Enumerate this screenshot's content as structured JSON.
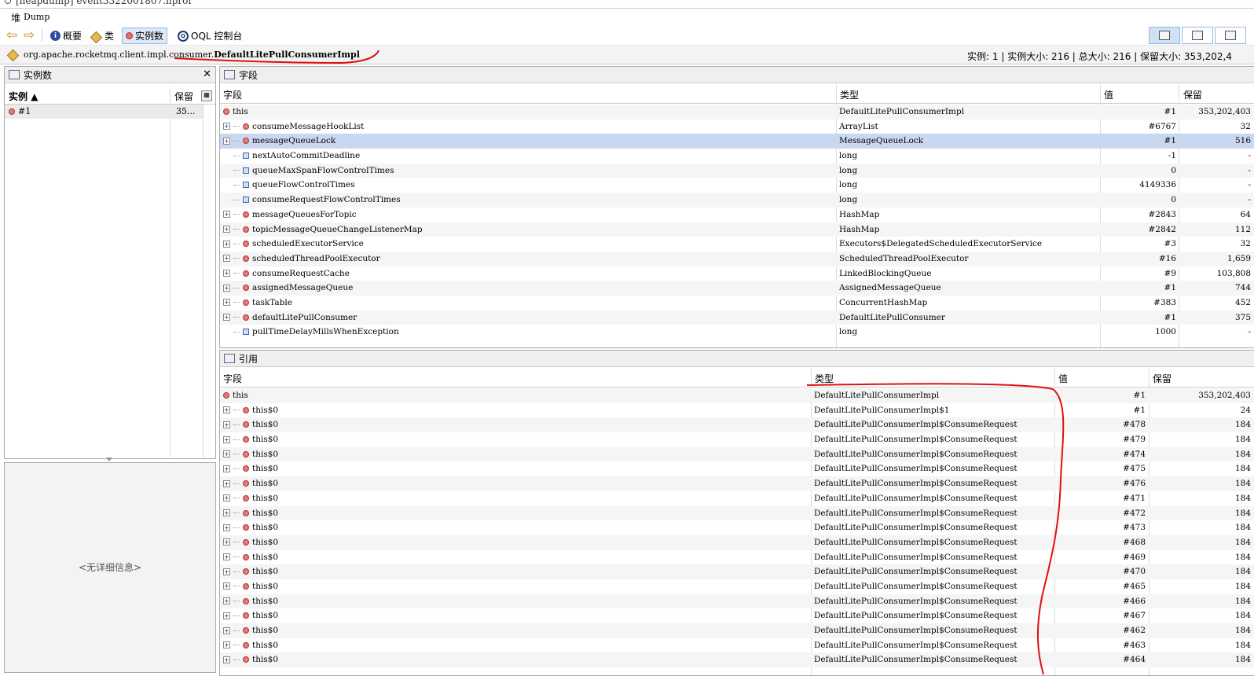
{
  "window": {
    "tab_title": "[heapdump] event3322001807.hprof",
    "heap_glyph": "堆",
    "title": "Dump"
  },
  "toolbar": {
    "back_icon": "arrow-left-icon",
    "forward_icon": "arrow-right-icon",
    "summary_label": "概要",
    "classes_label": "类",
    "instances_label": "实例数",
    "oql_label": "OQL 控制台"
  },
  "pathbar": {
    "package": "org.apache.rocketmq.client.impl.consumer.",
    "classname": "DefaultLitePullConsumerImpl",
    "stats": "实例: 1  |  实例大小: 216  |  总大小: 216  |  保留大小: 353,202,4"
  },
  "instances_panel": {
    "title": "实例数",
    "col_instance": "实例",
    "col_retained": "保留",
    "row": {
      "id": "#1",
      "retained": "35..."
    },
    "detail_empty": "<无详细信息>"
  },
  "fields_panel": {
    "title": "字段",
    "columns": {
      "field": "字段",
      "type": "类型",
      "value": "值",
      "retained": "保留"
    },
    "rows": [
      {
        "kind": "this",
        "name": "this",
        "type": "DefaultLitePullConsumerImpl",
        "value": "#1",
        "retained": "353,202,403"
      },
      {
        "kind": "obj",
        "name": "consumeMessageHookList",
        "type": "ArrayList",
        "value": "#6767",
        "retained": "32"
      },
      {
        "kind": "obj",
        "name": "messageQueueLock",
        "type": "MessageQueueLock",
        "value": "#1",
        "retained": "516",
        "selected": true
      },
      {
        "kind": "prim",
        "name": "nextAutoCommitDeadline",
        "type": "long",
        "value": "-1",
        "retained": "-"
      },
      {
        "kind": "prim",
        "name": "queueMaxSpanFlowControlTimes",
        "type": "long",
        "value": "0",
        "retained": "-"
      },
      {
        "kind": "prim",
        "name": "queueFlowControlTimes",
        "type": "long",
        "value": "4149336",
        "retained": "-"
      },
      {
        "kind": "prim",
        "name": "consumeRequestFlowControlTimes",
        "type": "long",
        "value": "0",
        "retained": "-"
      },
      {
        "kind": "obj",
        "name": "messageQueuesForTopic",
        "type": "HashMap",
        "value": "#2843",
        "retained": "64"
      },
      {
        "kind": "obj",
        "name": "topicMessageQueueChangeListenerMap",
        "type": "HashMap",
        "value": "#2842",
        "retained": "112"
      },
      {
        "kind": "obj",
        "name": "scheduledExecutorService",
        "type": "Executors$DelegatedScheduledExecutorService",
        "value": "#3",
        "retained": "32"
      },
      {
        "kind": "obj",
        "name": "scheduledThreadPoolExecutor",
        "type": "ScheduledThreadPoolExecutor",
        "value": "#16",
        "retained": "1,659"
      },
      {
        "kind": "obj",
        "name": "consumeRequestCache",
        "type": "LinkedBlockingQueue",
        "value": "#9",
        "retained": "103,808"
      },
      {
        "kind": "obj",
        "name": "assignedMessageQueue",
        "type": "AssignedMessageQueue",
        "value": "#1",
        "retained": "744"
      },
      {
        "kind": "obj",
        "name": "taskTable",
        "type": "ConcurrentHashMap",
        "value": "#383",
        "retained": "452"
      },
      {
        "kind": "obj",
        "name": "defaultLitePullConsumer",
        "type": "DefaultLitePullConsumer",
        "value": "#1",
        "retained": "375"
      },
      {
        "kind": "prim",
        "name": "pullTimeDelayMillsWhenException",
        "type": "long",
        "value": "1000",
        "retained": "-"
      }
    ]
  },
  "refs_panel": {
    "title": "引用",
    "columns": {
      "field": "字段",
      "type": "类型",
      "value": "值",
      "retained": "保留"
    },
    "rows": [
      {
        "kind": "this",
        "name": "this",
        "type": "DefaultLitePullConsumerImpl",
        "value": "#1",
        "retained": "353,202,403"
      },
      {
        "kind": "obj",
        "name": "this$0",
        "type": "DefaultLitePullConsumerImpl$1",
        "value": "#1",
        "retained": "24"
      },
      {
        "kind": "obj",
        "name": "this$0",
        "type": "DefaultLitePullConsumerImpl$ConsumeRequest",
        "value": "#478",
        "retained": "184"
      },
      {
        "kind": "obj",
        "name": "this$0",
        "type": "DefaultLitePullConsumerImpl$ConsumeRequest",
        "value": "#479",
        "retained": "184"
      },
      {
        "kind": "obj",
        "name": "this$0",
        "type": "DefaultLitePullConsumerImpl$ConsumeRequest",
        "value": "#474",
        "retained": "184"
      },
      {
        "kind": "obj",
        "name": "this$0",
        "type": "DefaultLitePullConsumerImpl$ConsumeRequest",
        "value": "#475",
        "retained": "184"
      },
      {
        "kind": "obj",
        "name": "this$0",
        "type": "DefaultLitePullConsumerImpl$ConsumeRequest",
        "value": "#476",
        "retained": "184"
      },
      {
        "kind": "obj",
        "name": "this$0",
        "type": "DefaultLitePullConsumerImpl$ConsumeRequest",
        "value": "#471",
        "retained": "184"
      },
      {
        "kind": "obj",
        "name": "this$0",
        "type": "DefaultLitePullConsumerImpl$ConsumeRequest",
        "value": "#472",
        "retained": "184"
      },
      {
        "kind": "obj",
        "name": "this$0",
        "type": "DefaultLitePullConsumerImpl$ConsumeRequest",
        "value": "#473",
        "retained": "184"
      },
      {
        "kind": "obj",
        "name": "this$0",
        "type": "DefaultLitePullConsumerImpl$ConsumeRequest",
        "value": "#468",
        "retained": "184"
      },
      {
        "kind": "obj",
        "name": "this$0",
        "type": "DefaultLitePullConsumerImpl$ConsumeRequest",
        "value": "#469",
        "retained": "184"
      },
      {
        "kind": "obj",
        "name": "this$0",
        "type": "DefaultLitePullConsumerImpl$ConsumeRequest",
        "value": "#470",
        "retained": "184"
      },
      {
        "kind": "obj",
        "name": "this$0",
        "type": "DefaultLitePullConsumerImpl$ConsumeRequest",
        "value": "#465",
        "retained": "184"
      },
      {
        "kind": "obj",
        "name": "this$0",
        "type": "DefaultLitePullConsumerImpl$ConsumeRequest",
        "value": "#466",
        "retained": "184"
      },
      {
        "kind": "obj",
        "name": "this$0",
        "type": "DefaultLitePullConsumerImpl$ConsumeRequest",
        "value": "#467",
        "retained": "184"
      },
      {
        "kind": "obj",
        "name": "this$0",
        "type": "DefaultLitePullConsumerImpl$ConsumeRequest",
        "value": "#462",
        "retained": "184"
      },
      {
        "kind": "obj",
        "name": "this$0",
        "type": "DefaultLitePullConsumerImpl$ConsumeRequest",
        "value": "#463",
        "retained": "184"
      },
      {
        "kind": "obj",
        "name": "this$0",
        "type": "DefaultLitePullConsumerImpl$ConsumeRequest",
        "value": "#464",
        "retained": "184"
      }
    ]
  },
  "colors": {
    "selection": "#c9d8f0",
    "annotation": "#e01010",
    "object_icon": "#e87a7a"
  }
}
